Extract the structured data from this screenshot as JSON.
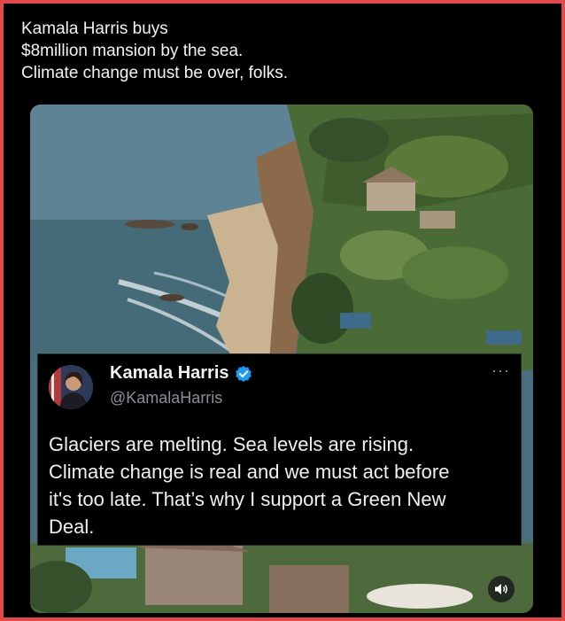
{
  "post": {
    "caption_lines": [
      "Kamala Harris buys",
      "$8million mansion by the sea.",
      "Climate change must be over, folks."
    ]
  },
  "embedded_tweet": {
    "author_name": "Kamala Harris",
    "author_handle": "@KamalaHarris",
    "more_label": "···",
    "verified_color": "#1d9bf0",
    "text_lines": [
      "Glaciers are melting. Sea levels are rising.",
      "Climate change is real and we must act before",
      "it's too late. That’s why I support a Green New",
      "Deal."
    ]
  },
  "media": {
    "sound_icon": "speaker-icon"
  },
  "colors": {
    "frame_border": "#e24a4a",
    "background": "#000000"
  }
}
